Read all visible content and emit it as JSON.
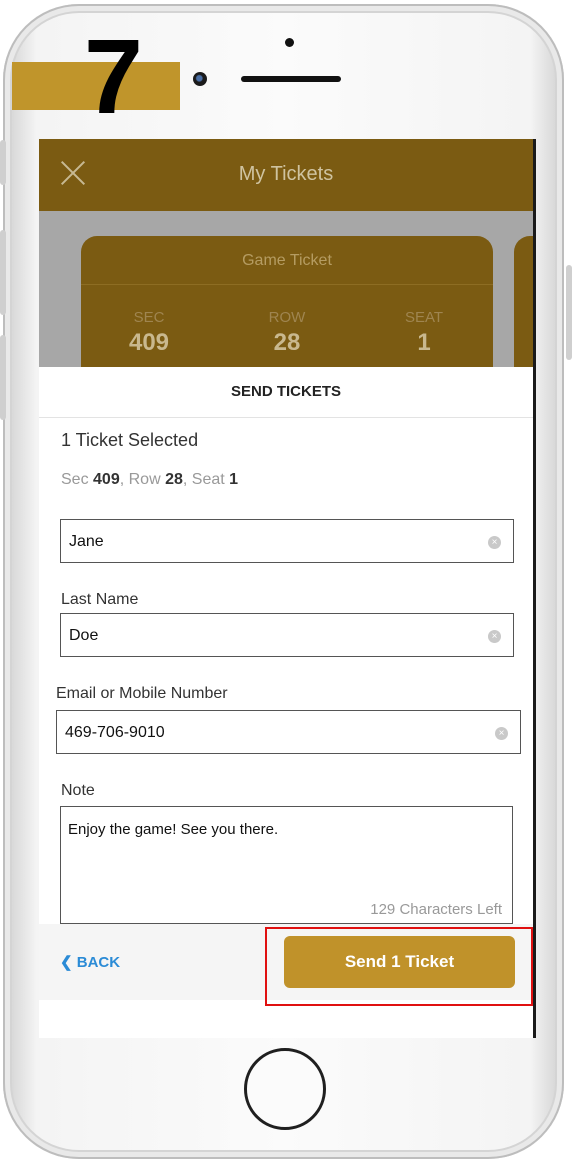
{
  "step": "7",
  "nav": {
    "title": "My Tickets"
  },
  "ticket_card": {
    "heading": "Game Ticket",
    "sec_label": "SEC",
    "sec_value": "409",
    "row_label": "ROW",
    "row_value": "28",
    "seat_label": "SEAT",
    "seat_value": "1"
  },
  "sheet": {
    "title": "SEND TICKETS",
    "selected_text": "1 Ticket Selected",
    "seat_summary": {
      "sec_label": "Sec",
      "sec": "409",
      "row_label": "Row",
      "row": "28",
      "seat_label": "Seat",
      "seat": "1"
    },
    "first_name_value": "Jane",
    "last_name_label": "Last Name",
    "last_name_value": "Doe",
    "contact_label": "Email or Mobile Number",
    "contact_value": "469-706-9010",
    "note_label": "Note",
    "note_value": "Enjoy the game! See you there.",
    "chars_left": "129 Characters Left"
  },
  "footer": {
    "back_label": "BACK",
    "send_label": "Send 1 Ticket"
  },
  "colors": {
    "brand_gold": "#c0922a",
    "nav_brown": "#7b5b12",
    "link_blue": "#2b8bd6",
    "highlight_red": "#e01010"
  }
}
